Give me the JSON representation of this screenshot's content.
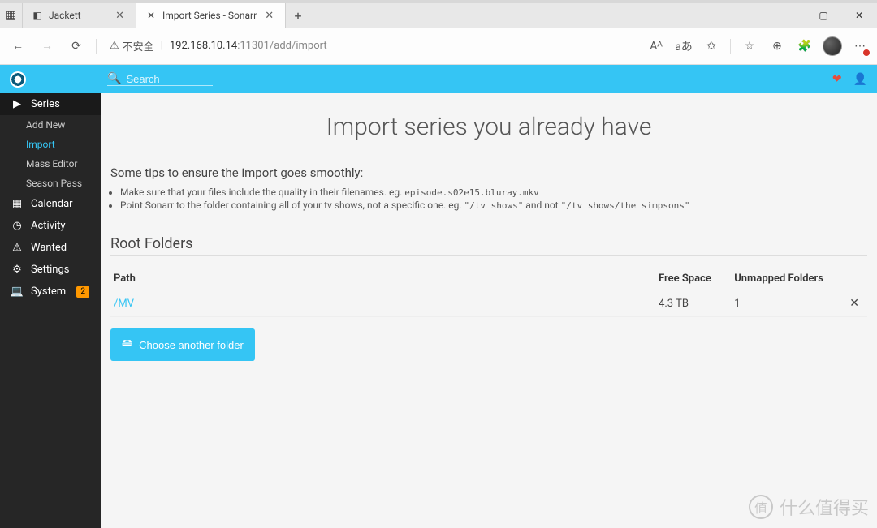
{
  "browser": {
    "tabs": [
      {
        "favicon": "◧",
        "title": "Jackett"
      },
      {
        "favicon": "✕",
        "title": "Import Series - Sonarr"
      }
    ],
    "security_label": "不安全",
    "url_host": "192.168.10.14",
    "url_rest": ":11301/add/import",
    "window": {
      "min": "—",
      "max": "▢",
      "close": "✕"
    }
  },
  "header": {
    "search_placeholder": "Search"
  },
  "sidebar": {
    "series": "Series",
    "add_new": "Add New",
    "import": "Import",
    "mass_editor": "Mass Editor",
    "season_pass": "Season Pass",
    "calendar": "Calendar",
    "activity": "Activity",
    "wanted": "Wanted",
    "settings": "Settings",
    "system": "System",
    "system_badge": "2"
  },
  "page": {
    "title": "Import series you already have",
    "tips_heading": "Some tips to ensure the import goes smoothly:",
    "tip1_a": "Make sure that your files include the quality in their filenames. eg. ",
    "tip1_code": "episode.s02e15.bluray.mkv",
    "tip2_a": "Point Sonarr to the folder containing all of your tv shows, not a specific one. eg. ",
    "tip2_code1": "\"/tv shows\"",
    "tip2_mid": " and not ",
    "tip2_code2": "\"/tv shows/the simpsons\"",
    "root_folders_heading": "Root Folders",
    "col_path": "Path",
    "col_free": "Free Space",
    "col_unmapped": "Unmapped Folders",
    "rows": [
      {
        "path": "/MV",
        "free": "4.3 TB",
        "unmapped": "1"
      }
    ],
    "choose_btn": "Choose another folder"
  },
  "watermark": "什么值得买"
}
